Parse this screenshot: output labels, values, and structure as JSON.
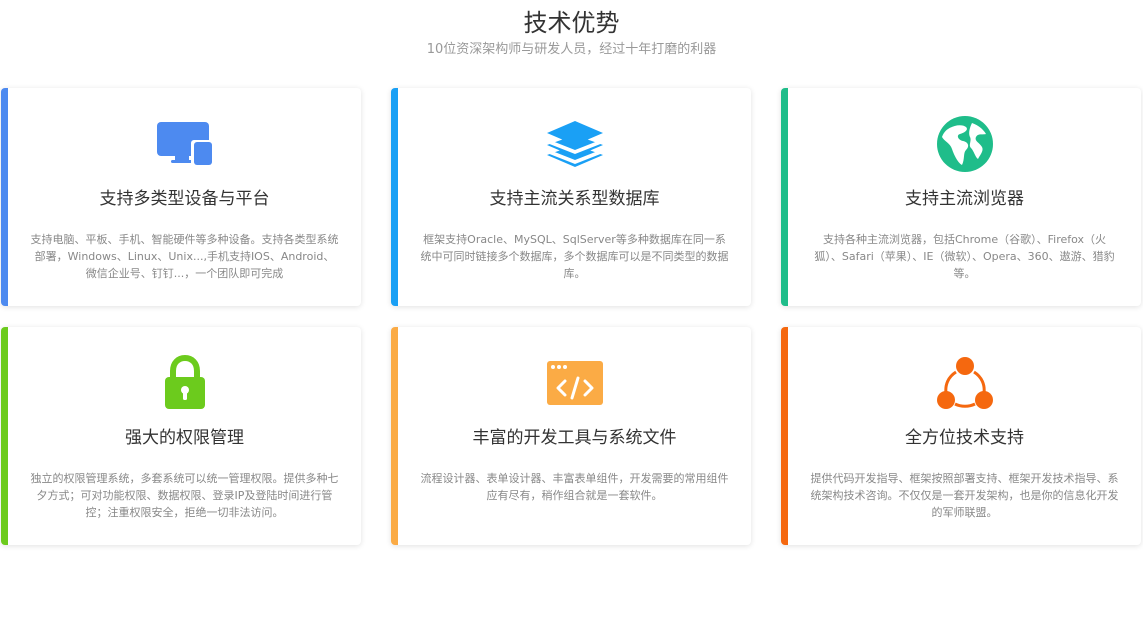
{
  "header": {
    "title": "技术优势",
    "subtitle": "10位资深架构师与研发人员，经过十年打磨的利器"
  },
  "cards": [
    {
      "title": "支持多类型设备与平台",
      "description": "支持电脑、平板、手机、智能硬件等多种设备。支持各类型系统部署，Windows、Linux、Unix...,手机支持IOS、Android、微信企业号、钉钉...，一个团队即可完成",
      "accent": "#4d8af0",
      "icon": "devices-icon"
    },
    {
      "title": "支持主流关系型数据库",
      "description": "框架支持Oracle、MySQL、SqlServer等多种数据库在同一系统中可同时链接多个数据库，多个数据库可以是不同类型的数据库。",
      "accent": "#1aa0f5",
      "icon": "database-layers-icon"
    },
    {
      "title": "支持主流浏览器",
      "description": "支持各种主流浏览器，包括Chrome（谷歌）、Firefox（火狐）、Safari（苹果）、IE（微软）、Opera、360、遨游、猎豹等。",
      "accent": "#1fbd8a",
      "icon": "globe-icon"
    },
    {
      "title": "强大的权限管理",
      "description": "独立的权限管理系统，多套系统可以统一管理权限。提供多种七夕方式；可对功能权限、数据权限、登录IP及登陆时间进行管控；注重权限安全，拒绝一切非法访问。",
      "accent": "#6ccb1d",
      "icon": "lock-icon"
    },
    {
      "title": "丰富的开发工具与系统文件",
      "description": "流程设计器、表单设计器、丰富表单组件，开发需要的常用组件应有尽有，稍作组合就是一套软件。",
      "accent": "#fbab45",
      "icon": "code-window-icon"
    },
    {
      "title": "全方位技术支持",
      "description": "提供代码开发指导、框架按照部署支持、框架开发技术指导、系统架构技术咨询。不仅仅是一套开发架构，也是你的信息化开发的军师联盟。",
      "accent": "#f5680f",
      "icon": "network-share-icon"
    }
  ]
}
